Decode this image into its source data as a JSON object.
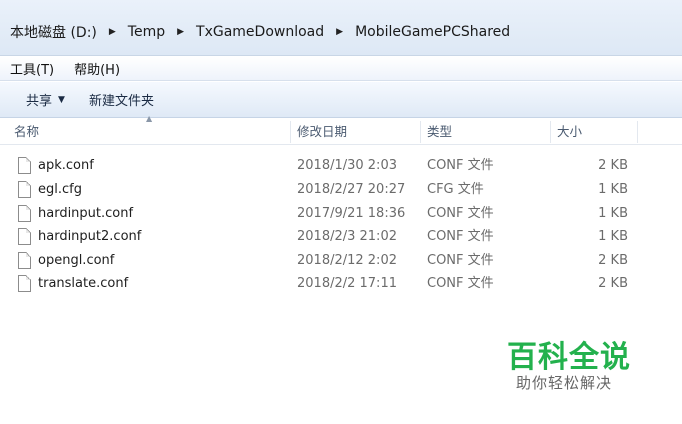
{
  "breadcrumb": [
    "本地磁盘 (D:)",
    "Temp",
    "TxGameDownload",
    "MobileGamePCShared"
  ],
  "menu": [
    "工具(T)",
    "帮助(H)"
  ],
  "toolbar": {
    "share_label": "共享",
    "new_folder_label": "新建文件夹"
  },
  "columns": {
    "name": "名称",
    "modified": "修改日期",
    "type": "类型",
    "size": "大小"
  },
  "files": [
    {
      "name": "apk.conf",
      "modified": "2018/1/30 2:03",
      "type": "CONF 文件",
      "size": "2 KB"
    },
    {
      "name": "egl.cfg",
      "modified": "2018/2/27 20:27",
      "type": "CFG 文件",
      "size": "1 KB"
    },
    {
      "name": "hardinput.conf",
      "modified": "2017/9/21 18:36",
      "type": "CONF 文件",
      "size": "1 KB"
    },
    {
      "name": "hardinput2.conf",
      "modified": "2018/2/3 21:02",
      "type": "CONF 文件",
      "size": "1 KB"
    },
    {
      "name": "opengl.conf",
      "modified": "2018/2/12 2:02",
      "type": "CONF 文件",
      "size": "2 KB"
    },
    {
      "name": "translate.conf",
      "modified": "2018/2/2 17:11",
      "type": "CONF 文件",
      "size": "2 KB"
    }
  ],
  "watermark": {
    "title": "百科全说",
    "subtitle": "助你轻松解决"
  },
  "colors": {
    "watermark_green": "#23b14d"
  }
}
